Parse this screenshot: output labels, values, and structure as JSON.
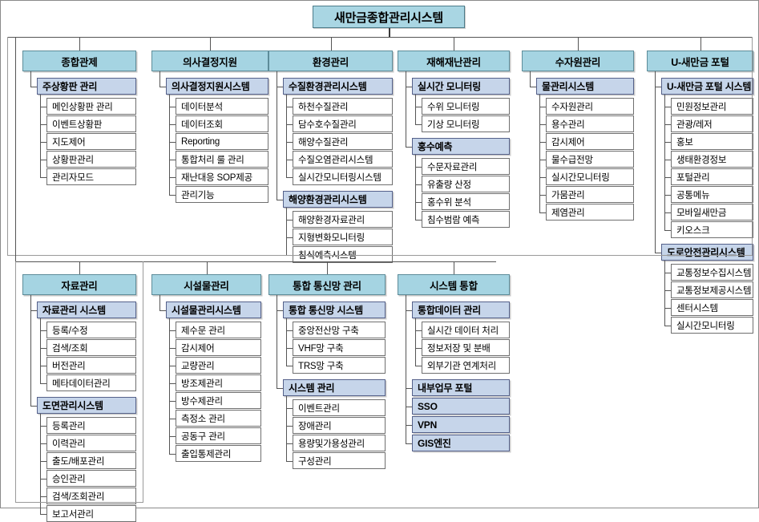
{
  "diagram": {
    "title": "새만금종합관리시스템",
    "groups_row1": [
      {
        "header": "종합관제",
        "sections": [
          {
            "title": "주상황판 관리",
            "items": [
              "메인상황판 관리",
              "이벤트상황판",
              "지도제어",
              "상황판관리",
              "관리자모드"
            ]
          }
        ]
      },
      {
        "header": "의사결정지원",
        "sections": [
          {
            "title": "의사결정지원시스템",
            "items": [
              "데이터분석",
              "데이터조회",
              "Reporting",
              "통합처리 룰 관리",
              "재난대응 SOP제공",
              "관리기능"
            ]
          }
        ]
      },
      {
        "header": "환경관리",
        "sections": [
          {
            "title": "수질환경관리시스템",
            "items": [
              "하천수질관리",
              "담수호수질관리",
              "해양수질관리",
              "수질오염관리시스템",
              "실시간모니터링시스템"
            ]
          },
          {
            "title": "해양환경관리시스템",
            "items": [
              "해양환경자료관리",
              "지형변화모니터링",
              "침식예측시스템"
            ]
          }
        ]
      },
      {
        "header": "재해재난관리",
        "sections": [
          {
            "title": "실시간 모니터링",
            "items": [
              "수위 모니터링",
              "기상 모니터링"
            ]
          },
          {
            "title": "홍수예측",
            "items": [
              "수문자료관리",
              "유출량 산정",
              "홍수위 분석",
              "침수범람 예측"
            ]
          }
        ]
      },
      {
        "header": "수자원관리",
        "sections": [
          {
            "title": "물관리시스템",
            "items": [
              "수자원관리",
              "용수관리",
              "감시제어",
              "물수급전망",
              "실시간모니터링",
              "가뭄관리",
              "제염관리"
            ]
          }
        ]
      },
      {
        "header": "U-새만금 포털",
        "sections": [
          {
            "title": "U-새만금 포털 시스템",
            "items": [
              "민원정보관리",
              "관광/레저",
              "홍보",
              "생태환경정보",
              "포털관리",
              "공통메뉴",
              "모바일새만금",
              "키오스크"
            ]
          },
          {
            "title": "도로안전관리시스템",
            "items": [
              "교통정보수집시스템",
              "교통정보제공시스템",
              "센터시스템",
              "실시간모니터링"
            ]
          }
        ]
      }
    ],
    "groups_row2": [
      {
        "header": "자료관리",
        "sections": [
          {
            "title": "자료관리 시스템",
            "items": [
              "등록/수정",
              "검색/조회",
              "버전관리",
              "메타데이터관리"
            ]
          },
          {
            "title": "도면관리시스템",
            "items": [
              "등록관리",
              "이력관리",
              "출도/배포관리",
              "승인관리",
              "검색/조회관리",
              "보고서관리"
            ]
          }
        ]
      },
      {
        "header": "시설물관리",
        "sections": [
          {
            "title": "시설물관리시스템",
            "items": [
              "제수문 관리",
              "감시제어",
              "교량관리",
              "방조제관리",
              "방수제관리",
              "측정소 관리",
              "공동구 관리",
              "출입통제관리"
            ]
          }
        ]
      },
      {
        "header": "통합 통신망 관리",
        "sections": [
          {
            "title": "통합 통신망 시스템",
            "items": [
              "중앙전산망 구축",
              "VHF망 구축",
              "TRS망 구축"
            ]
          },
          {
            "title": "시스템 관리",
            "items": [
              "이벤트관리",
              "장애관리",
              "용량및가용성관리",
              "구성관리"
            ]
          }
        ]
      },
      {
        "header": "시스템 통합",
        "sections": [
          {
            "title": "통합데이터 관리",
            "items": [
              "실시간 데이터 처리",
              "정보저장 및 분배",
              "외부기관 연계처리"
            ]
          },
          {
            "title": "내부업무 포털",
            "items": []
          },
          {
            "title": "SSO",
            "items": []
          },
          {
            "title": "VPN",
            "items": []
          },
          {
            "title": "GIS엔진",
            "items": []
          }
        ]
      }
    ]
  },
  "colors": {
    "root_fill": "#a9d6e3",
    "level1_fill": "#a5d4e2",
    "level2_fill": "#c6d5ea",
    "level3_fill": "#ffffff",
    "line": "#555555",
    "border": "#6f6f6f"
  }
}
